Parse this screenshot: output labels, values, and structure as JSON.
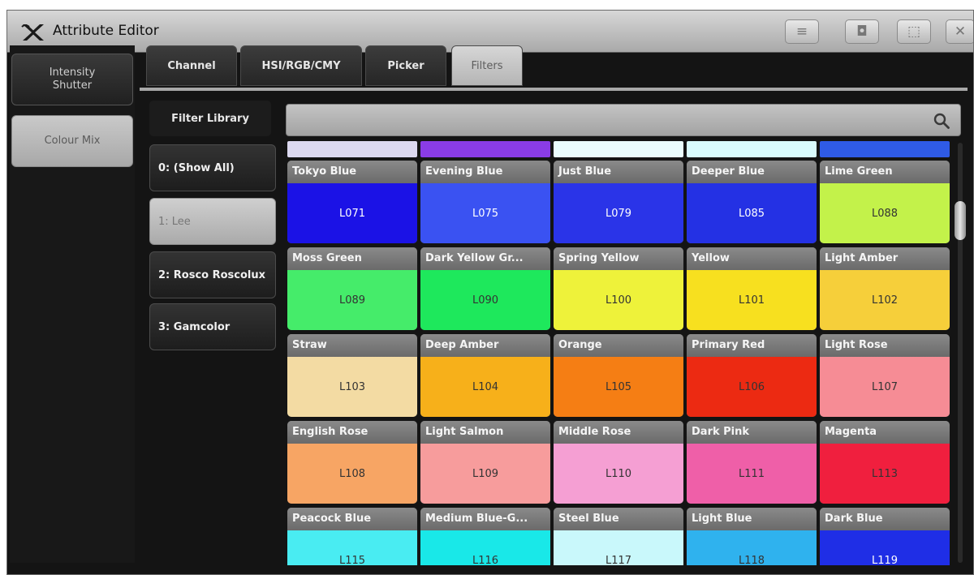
{
  "window": {
    "title": "Attribute Editor",
    "controls": [
      {
        "icon": "menu-lines-icon",
        "glyph": "≡"
      },
      {
        "icon": "settings-icon",
        "glyph": "◘"
      },
      {
        "icon": "restore-window-icon",
        "glyph": "⬚"
      },
      {
        "icon": "close-icon",
        "glyph": "✕"
      }
    ]
  },
  "sidebar": {
    "items": [
      {
        "label": "Intensity\nShutter",
        "state": "dark"
      },
      {
        "label": "Colour Mix",
        "state": "light"
      }
    ]
  },
  "tabs": [
    {
      "label": "Channel",
      "active": false
    },
    {
      "label": "HSI/RGB/CMY",
      "active": false
    },
    {
      "label": "Picker",
      "active": false
    },
    {
      "label": "Filters",
      "active": true
    }
  ],
  "library": {
    "header": "Filter Library",
    "items": [
      {
        "label": "0: (Show All)",
        "selected": false
      },
      {
        "label": "1: Lee",
        "selected": true
      },
      {
        "label": "2: Rosco Roscolux",
        "selected": false
      },
      {
        "label": "3: Gamcolor",
        "selected": false
      }
    ]
  },
  "search": {
    "value": ""
  },
  "partial_row_colors": [
    "#dcd9f0",
    "#8a3ce6",
    "#eafcfd",
    "#d9fbfd",
    "#2f5be6"
  ],
  "filters": [
    {
      "name": "Tokyo Blue",
      "code": "L071",
      "color": "#1b12e6",
      "text": "#ffffff"
    },
    {
      "name": "Evening Blue",
      "code": "L075",
      "color": "#3a52f2",
      "text": "#ffffff"
    },
    {
      "name": "Just Blue",
      "code": "L079",
      "color": "#2a34e8",
      "text": "#ffffff"
    },
    {
      "name": "Deeper Blue",
      "code": "L085",
      "color": "#2431e4",
      "text": "#ffffff"
    },
    {
      "name": "Lime Green",
      "code": "L088",
      "color": "#c3f24a",
      "text": "#333333"
    },
    {
      "name": "Moss Green",
      "code": "L089",
      "color": "#45ec6a",
      "text": "#333333"
    },
    {
      "name": "Dark Yellow Gr...",
      "code": "L090",
      "color": "#1ee85c",
      "text": "#333333"
    },
    {
      "name": "Spring Yellow",
      "code": "L100",
      "color": "#eef23a",
      "text": "#333333"
    },
    {
      "name": "Yellow",
      "code": "L101",
      "color": "#f7e01f",
      "text": "#333333"
    },
    {
      "name": "Light Amber",
      "code": "L102",
      "color": "#f6cf3a",
      "text": "#333333"
    },
    {
      "name": "Straw",
      "code": "L103",
      "color": "#f3dba3",
      "text": "#333333"
    },
    {
      "name": "Deep Amber",
      "code": "L104",
      "color": "#f7b01a",
      "text": "#333333"
    },
    {
      "name": "Orange",
      "code": "L105",
      "color": "#f57e14",
      "text": "#333333"
    },
    {
      "name": "Primary Red",
      "code": "L106",
      "color": "#ec2a12",
      "text": "#333333"
    },
    {
      "name": "Light Rose",
      "code": "L107",
      "color": "#f68c95",
      "text": "#333333"
    },
    {
      "name": "English Rose",
      "code": "L108",
      "color": "#f7a564",
      "text": "#333333"
    },
    {
      "name": "Light Salmon",
      "code": "L109",
      "color": "#f79c9c",
      "text": "#333333"
    },
    {
      "name": "Middle Rose",
      "code": "L110",
      "color": "#f59fd3",
      "text": "#333333"
    },
    {
      "name": "Dark Pink",
      "code": "L111",
      "color": "#ef5fa8",
      "text": "#333333"
    },
    {
      "name": "Magenta",
      "code": "L113",
      "color": "#f01f3e",
      "text": "#333333"
    },
    {
      "name": "Peacock Blue",
      "code": "L115",
      "color": "#49ecf2",
      "text": "#333333"
    },
    {
      "name": "Medium Blue-G...",
      "code": "L116",
      "color": "#19e8e8",
      "text": "#333333"
    },
    {
      "name": "Steel Blue",
      "code": "L117",
      "color": "#c9f8fb",
      "text": "#333333"
    },
    {
      "name": "Light Blue",
      "code": "L118",
      "color": "#2fb2ee",
      "text": "#333333"
    },
    {
      "name": "Dark Blue",
      "code": "L119",
      "color": "#1f2ee6",
      "text": "#ffffff"
    }
  ]
}
